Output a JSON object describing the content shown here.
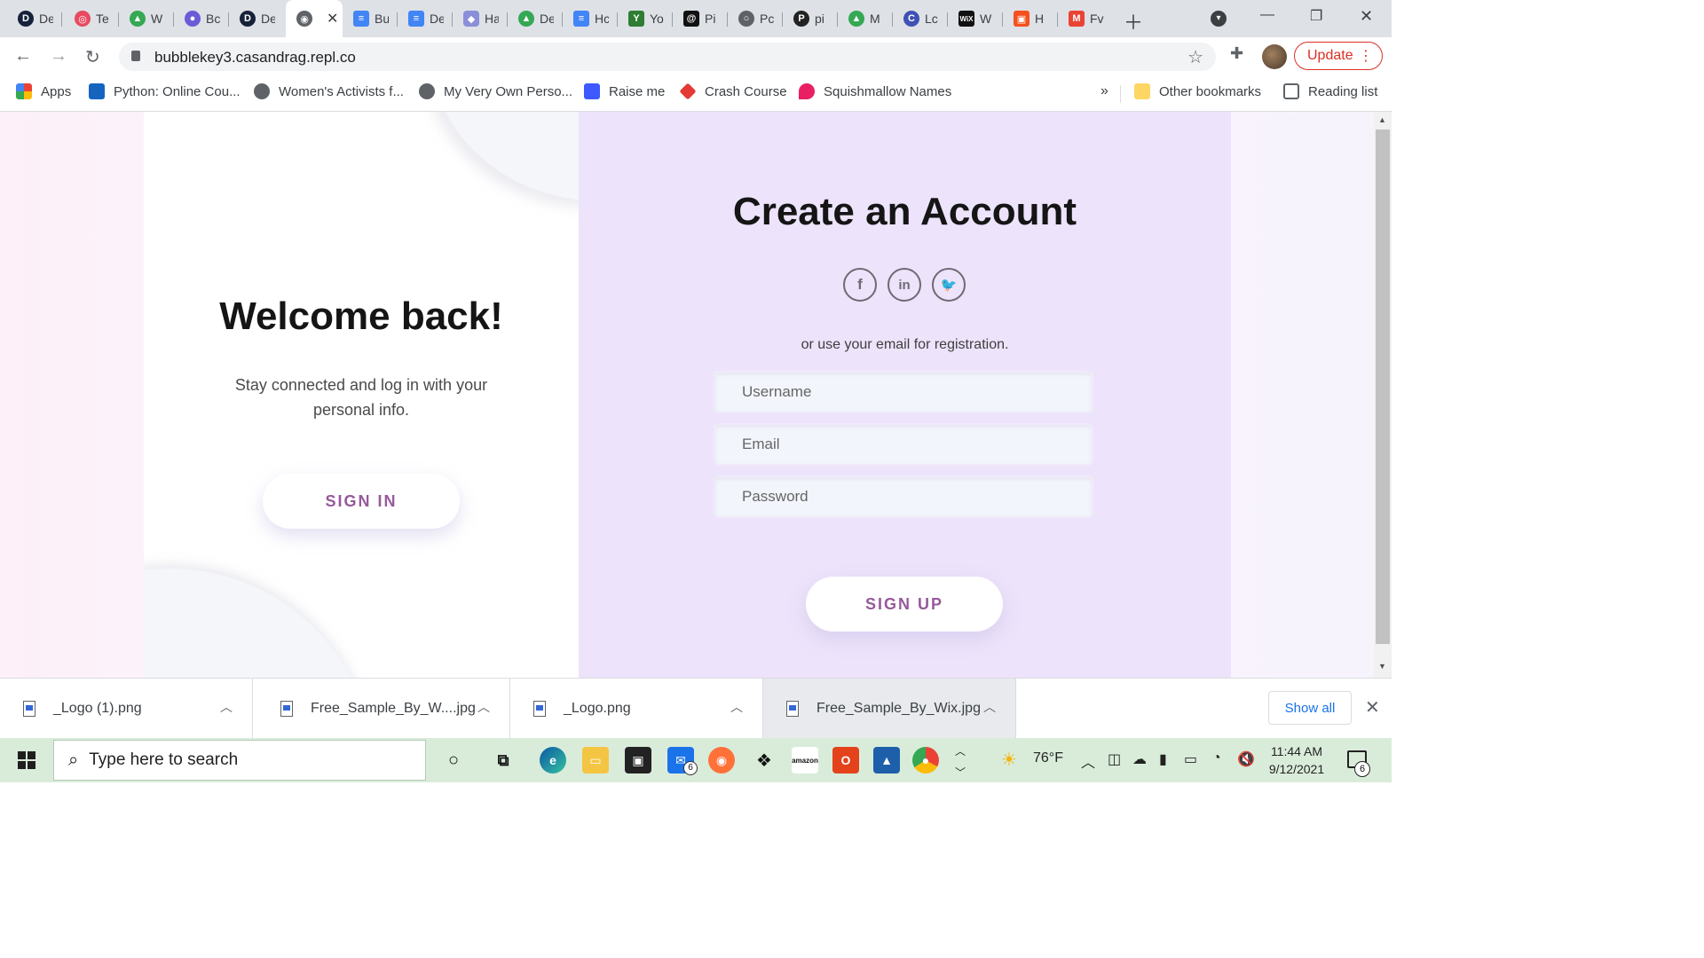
{
  "browser": {
    "tabs": [
      {
        "label": "De",
        "icon": "dictionary-icon",
        "color": "#16223a"
      },
      {
        "label": "Te",
        "icon": "target-icon",
        "color": "#e84a5f"
      },
      {
        "label": "W",
        "icon": "google-drive-icon",
        "color": "#34a853"
      },
      {
        "label": "Bc",
        "icon": "notification-badge-icon",
        "color": "#6b5bd6"
      },
      {
        "label": "De",
        "icon": "dictionary-icon",
        "color": "#16223a"
      },
      {
        "label": "",
        "icon": "globe-icon",
        "color": "#5f6368"
      },
      {
        "label": "Bu",
        "icon": "google-docs-icon",
        "color": "#4285f4"
      },
      {
        "label": "De",
        "icon": "google-docs-icon",
        "color": "#4285f4"
      },
      {
        "label": "Ha",
        "icon": "discord-icon",
        "color": "#8a8fd8"
      },
      {
        "label": "De",
        "icon": "google-drive-icon",
        "color": "#34a853"
      },
      {
        "label": "Hc",
        "icon": "google-docs-icon",
        "color": "#4285f4"
      },
      {
        "label": "Yo",
        "icon": "y-logo-icon",
        "color": "#2e7d32"
      },
      {
        "label": "Pi",
        "icon": "spiral-icon",
        "color": "#111111"
      },
      {
        "label": "Pc",
        "icon": "circle-logo-icon",
        "color": "#5f6368"
      },
      {
        "label": "pi",
        "icon": "p-logo-icon",
        "color": "#222222"
      },
      {
        "label": "M",
        "icon": "google-drive-icon",
        "color": "#34a853"
      },
      {
        "label": "Lc",
        "icon": "c-logo-icon",
        "color": "#3f51b5"
      },
      {
        "label": "W",
        "icon": "wix-icon",
        "color": "#111111"
      },
      {
        "label": "H",
        "icon": "orange-square-icon",
        "color": "#f4511e"
      },
      {
        "label": "Fv",
        "icon": "gmail-icon",
        "color": "#ea4335"
      }
    ],
    "active_tab_index": 5,
    "url": "bubblekey3.casandrag.repl.co",
    "update_label": "Update",
    "accent_color": "#d93025",
    "bookmarks": [
      {
        "label": "Apps",
        "icon": "apps-grid-icon"
      },
      {
        "label": "Python: Online Cou...",
        "icon": "video-icon"
      },
      {
        "label": "Women's Activists f...",
        "icon": "globe-icon"
      },
      {
        "label": "My Very Own Perso...",
        "icon": "globe-icon"
      },
      {
        "label": "Raise me",
        "icon": "raise-me-icon"
      },
      {
        "label": "Crash Course",
        "icon": "crash-course-icon"
      },
      {
        "label": "Squishmallow Names",
        "icon": "flame-icon"
      }
    ],
    "more_bookmarks": "»",
    "other_bookmarks": "Other bookmarks",
    "reading_list": "Reading list"
  },
  "page": {
    "welcome_title": "Welcome back!",
    "welcome_text": "Stay connected and log in with your personal info.",
    "sign_in_label": "SIGN IN",
    "create_title": "Create an Account",
    "socials": [
      {
        "name": "facebook",
        "glyph": "f"
      },
      {
        "name": "linkedin",
        "glyph": "in"
      },
      {
        "name": "twitter",
        "glyph": "🐦"
      }
    ],
    "registration_text": "or use your email for registration.",
    "fields": {
      "username_placeholder": "Username",
      "email_placeholder": "Email",
      "password_placeholder": "Password"
    },
    "sign_up_label": "SIGN UP",
    "button_text_color": "#96599c",
    "right_panel_color": "#ede3fb"
  },
  "downloads": {
    "items": [
      {
        "name": "_Logo (1).png"
      },
      {
        "name": "Free_Sample_By_W....jpg"
      },
      {
        "name": "_Logo.png"
      },
      {
        "name": "Free_Sample_By_Wix.jpg"
      }
    ],
    "show_all_label": "Show all"
  },
  "taskbar": {
    "search_placeholder": "Type here to search",
    "mail_badge": "6",
    "weather": "76°F",
    "time": "11:44 AM",
    "date": "9/12/2021",
    "notification_count": "6"
  }
}
